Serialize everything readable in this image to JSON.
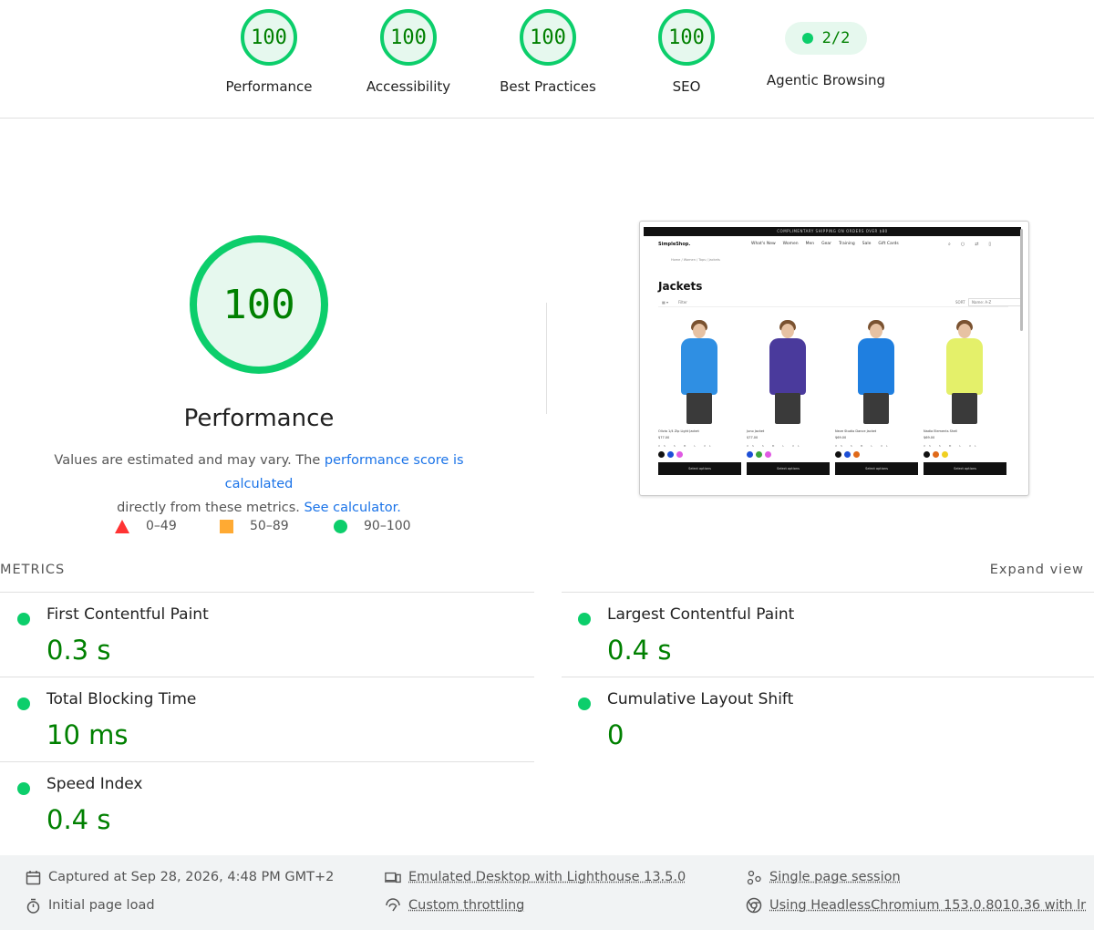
{
  "scores": [
    {
      "value": "100",
      "label": "Performance"
    },
    {
      "value": "100",
      "label": "Accessibility"
    },
    {
      "value": "100",
      "label": "Best Practices"
    },
    {
      "value": "100",
      "label": "SEO"
    }
  ],
  "agentic": {
    "value": "2/2",
    "label": "Agentic Browsing"
  },
  "performance": {
    "score": "100",
    "title": "Performance",
    "desc_prefix": "Values are estimated and may vary. The ",
    "desc_link": "performance score is calculated",
    "desc_mid": "directly from these metrics. ",
    "calc_link": "See calculator."
  },
  "legend": {
    "poor": "0–49",
    "average": "50–89",
    "good": "90–100"
  },
  "thumbnail": {
    "promo": "COMPLIMENTARY SHIPPING ON ORDERS OVER $80",
    "logo": "SimpleShop.",
    "nav": [
      "What's New",
      "Women",
      "Men",
      "Gear",
      "Training",
      "Sale",
      "Gift Cards"
    ],
    "breadcrumb": "Home  /  Women  /  Tops  /  Jackets",
    "title": "Jackets",
    "filter_label": "Filter",
    "sort_label": "SORT",
    "sort_value": "Name: A-Z",
    "sizes": "XS S M L XL",
    "select_label": "Select options",
    "products": [
      {
        "name": "Olivia 1/4 Zip Light Jacket",
        "price": "$77.00",
        "color": "#2f8fe3",
        "swatches": [
          "#111111",
          "#1d4fd6",
          "#e05ae3"
        ]
      },
      {
        "name": "Juno Jacket",
        "price": "$77.00",
        "color": "#4a3a9c",
        "swatches": [
          "#1d4fd6",
          "#3aa53a",
          "#e05ae3"
        ]
      },
      {
        "name": "Neve Studio Dance Jacket",
        "price": "$69.00",
        "color": "#1f7fe0",
        "swatches": [
          "#111111",
          "#1d4fd6",
          "#e06a1a"
        ]
      },
      {
        "name": "Nadia Elements Shell",
        "price": "$69.00",
        "color": "#e4f06a",
        "swatches": [
          "#111111",
          "#e06a1a",
          "#f0d020"
        ]
      }
    ]
  },
  "metrics": {
    "heading": "METRICS",
    "expand": "Expand view",
    "fcp": {
      "label": "First Contentful Paint",
      "value": "0.3 s"
    },
    "lcp": {
      "label": "Largest Contentful Paint",
      "value": "0.4 s"
    },
    "tbt": {
      "label": "Total Blocking Time",
      "value": "10 ms"
    },
    "cls": {
      "label": "Cumulative Layout Shift",
      "value": "0"
    },
    "si": {
      "label": "Speed Index",
      "value": "0.4 s"
    }
  },
  "footer": {
    "captured": "Captured at Sep 28, 2026, 4:48 PM GMT+2",
    "load": "Initial page load",
    "emulated": "Emulated Desktop with Lighthouse 13.5.0",
    "throttling": "Custom throttling",
    "session": "Single page session",
    "browser": "Using HeadlessChromium 153.0.8010.36 with lr"
  },
  "colors": {
    "pass": "#0cce6b",
    "pass_text": "#008000",
    "average": "#ffaa33",
    "fail": "#ff3333",
    "link": "#1a73e8"
  }
}
